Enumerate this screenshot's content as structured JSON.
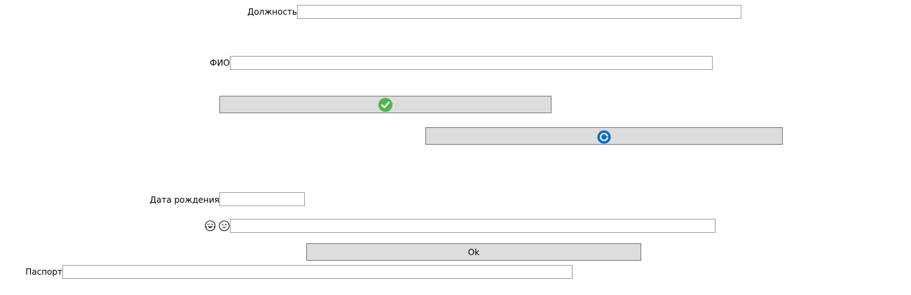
{
  "form": {
    "position_label": "Должность",
    "position_value": "",
    "fio_label": "ФИО",
    "fio_value": "",
    "birthdate_label": "Дата рождения",
    "birthdate_value": "",
    "emoji_field_value": "",
    "passport_label": "Паспорт",
    "passport_value": "",
    "ok_label": "Ok"
  },
  "icons": {
    "confirm": "checkmark-circle-icon",
    "refresh": "refresh-icon",
    "emoji_1": "laughing-tears-emoji-icon",
    "emoji_2": "grinning-emoji-icon"
  },
  "colors": {
    "button_bg": "#dddddd",
    "checkmark_green": "#4cb848",
    "refresh_blue": "#0a6fc2",
    "field_border": "#a0a0a0"
  }
}
